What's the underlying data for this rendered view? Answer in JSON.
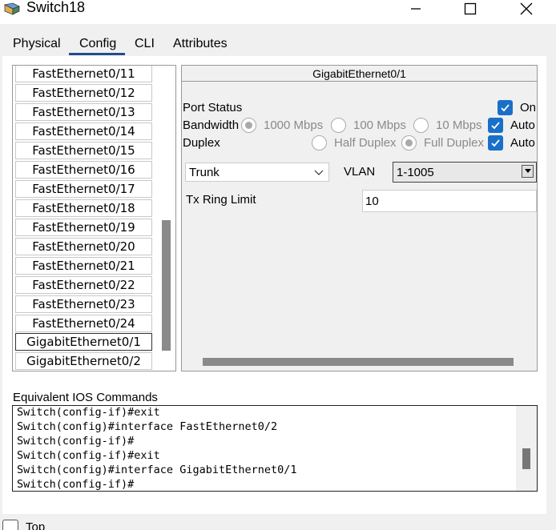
{
  "window": {
    "title": "Switch18"
  },
  "tabs": [
    {
      "label": "Physical"
    },
    {
      "label": "Config"
    },
    {
      "label": "CLI"
    },
    {
      "label": "Attributes"
    }
  ],
  "interfaces": [
    "FastEthernet0/11",
    "FastEthernet0/12",
    "FastEthernet0/13",
    "FastEthernet0/14",
    "FastEthernet0/15",
    "FastEthernet0/16",
    "FastEthernet0/17",
    "FastEthernet0/18",
    "FastEthernet0/19",
    "FastEthernet0/20",
    "FastEthernet0/21",
    "FastEthernet0/22",
    "FastEthernet0/23",
    "FastEthernet0/24",
    "GigabitEthernet0/1",
    "GigabitEthernet0/2"
  ],
  "selected_interface": "GigabitEthernet0/1",
  "panel": {
    "title": "GigabitEthernet0/1",
    "port_status_label": "Port Status",
    "on_label": "On",
    "on_checked": true,
    "bandwidth_label": "Bandwidth",
    "bw_1000": "1000 Mbps",
    "bw_100": "100 Mbps",
    "bw_10": "10 Mbps",
    "bw_selected": "1000 Mbps",
    "bandwidth_auto_label": "Auto",
    "bandwidth_auto": true,
    "duplex_label": "Duplex",
    "half_duplex": "Half Duplex",
    "full_duplex": "Full Duplex",
    "duplex_selected": "Full Duplex",
    "duplex_auto_label": "Auto",
    "duplex_auto": true,
    "mode_value": "Trunk",
    "vlan_label": "VLAN",
    "vlan_value": "1-1005",
    "tx_ring_label": "Tx Ring Limit",
    "tx_ring_value": "10"
  },
  "ios": {
    "label": "Equivalent IOS Commands",
    "lines": [
      "Switch(config-if)#exit",
      "Switch(config)#interface FastEthernet0/2",
      "Switch(config-if)#",
      "Switch(config-if)#exit",
      "Switch(config)#interface GigabitEthernet0/1",
      "Switch(config-if)#"
    ]
  },
  "bottom": {
    "top_label": "Top",
    "top_checked": false
  },
  "colors": {
    "accent": "#1a6fc9",
    "tab_underline": "#1f4e8c"
  }
}
